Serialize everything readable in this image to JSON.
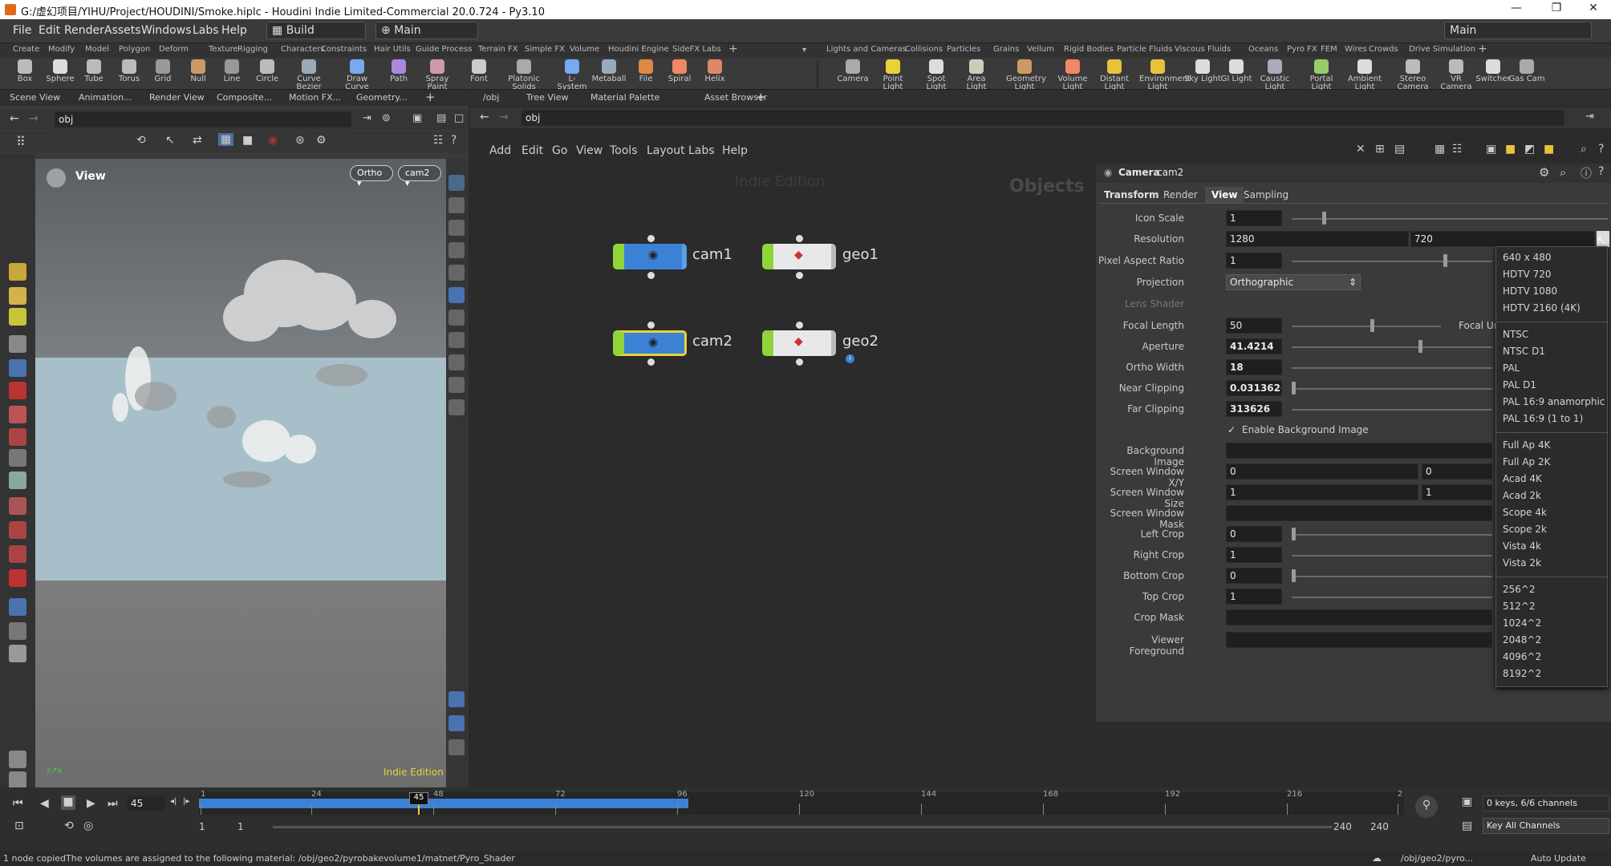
{
  "window": {
    "title": "G:/虚幻项目/YIHU/Project/HOUDINI/Smoke.hiplc - Houdini Indie Limited-Commercial 20.0.724 - Py3.10",
    "minimize": "—",
    "maximize": "❐",
    "close": "✕"
  },
  "menubar": {
    "items": [
      "File",
      "Edit",
      "Render",
      "Assets",
      "Windows",
      "Labs",
      "Help"
    ],
    "build_label": "Build",
    "main_label": "Main",
    "desktop_label": "Main"
  },
  "shelf_tabs_left": [
    "Create",
    "Modify",
    "Model",
    "Polygon",
    "Deform",
    "Texture",
    "Rigging",
    "Characters",
    "Constraints",
    "Hair Utils",
    "Guide Process",
    "Terrain FX",
    "Simple FX",
    "Volume",
    "Houdini Engine",
    "SideFX Labs"
  ],
  "shelf_tabs_right": [
    "Lights and Cameras",
    "Collisions",
    "Particles",
    "Grains",
    "Vellum",
    "Rigid Bodies",
    "Particle Fluids",
    "Viscous Fluids",
    "Oceans",
    "Pyro FX",
    "FEM",
    "Wires",
    "Crowds",
    "Drive Simulation"
  ],
  "shelf_tools_left": [
    "Box",
    "Sphere",
    "Tube",
    "Torus",
    "Grid",
    "Null",
    "Line",
    "Circle",
    "Curve Bezier",
    "Draw Curve",
    "Path",
    "Spray Paint",
    "Font",
    "Platonic Solids",
    "L-System",
    "Metaball",
    "File",
    "Spiral",
    "Helix"
  ],
  "shelf_tools_right": [
    "Camera",
    "Point Light",
    "Spot Light",
    "Area Light",
    "Geometry Light",
    "Volume Light",
    "Distant Light",
    "Environment Light",
    "Sky Light",
    "GI Light",
    "Caustic Light",
    "Portal Light",
    "Ambient Light",
    "Stereo Camera",
    "VR Camera",
    "Switcher",
    "Gas Cam"
  ],
  "left_pane": {
    "tabs": [
      "Scene View",
      "Animation...",
      "Render View",
      "Composite...",
      "Motion FX...",
      "Geometry..."
    ],
    "path": "obj",
    "view_label": "View",
    "ortho_label": "Ortho",
    "camera_label": "cam2",
    "watermark": "Indie Edition"
  },
  "network": {
    "tabs": [
      "/obj",
      "Tree View",
      "Material Palette",
      "Asset Browser"
    ],
    "path": "obj",
    "menu": [
      "Add",
      "Edit",
      "Go",
      "View",
      "Tools",
      "Layout",
      "Labs",
      "Help"
    ],
    "watermark": "Indie Edition",
    "context_label": "Objects",
    "nodes": [
      {
        "name": "cam1"
      },
      {
        "name": "geo1"
      },
      {
        "name": "cam2"
      },
      {
        "name": "geo2"
      }
    ]
  },
  "params": {
    "node_type": "Camera",
    "node_name": "cam2",
    "tabs": [
      "Transform",
      "Render",
      "View",
      "Sampling"
    ],
    "active_tab": "View",
    "rows": {
      "icon_scale": {
        "label": "Icon Scale",
        "value": "1"
      },
      "resolution": {
        "label": "Resolution",
        "x": "1280",
        "y": "720"
      },
      "pixel_aspect": {
        "label": "Pixel Aspect Ratio",
        "value": "1"
      },
      "projection": {
        "label": "Projection",
        "value": "Orthographic"
      },
      "lens_shader": {
        "label": "Lens Shader"
      },
      "focal_length": {
        "label": "Focal Length",
        "value": "50",
        "units_label": "Focal Un"
      },
      "aperture": {
        "label": "Aperture",
        "value": "41.4214"
      },
      "ortho_width": {
        "label": "Ortho Width",
        "value": "18"
      },
      "near_clipping": {
        "label": "Near Clipping",
        "value": "0.0313626"
      },
      "far_clipping": {
        "label": "Far Clipping",
        "value": "313626"
      },
      "enable_bg": {
        "label": "Enable Background Image"
      },
      "bg_image": {
        "label": "Background Image"
      },
      "screen_window_xy": {
        "label": "Screen Window X/Y",
        "x": "0",
        "y": "0"
      },
      "screen_window_size": {
        "label": "Screen Window Size",
        "x": "1",
        "y": "1"
      },
      "screen_window_mask": {
        "label": "Screen Window Mask"
      },
      "left_crop": {
        "label": "Left Crop",
        "value": "0"
      },
      "right_crop": {
        "label": "Right Crop",
        "value": "1"
      },
      "bottom_crop": {
        "label": "Bottom Crop",
        "value": "0"
      },
      "top_crop": {
        "label": "Top Crop",
        "value": "1"
      },
      "crop_mask": {
        "label": "Crop Mask"
      },
      "viewer_foreground": {
        "label": "Viewer Foreground"
      }
    }
  },
  "resolution_menu": {
    "groups": [
      [
        "640 x 480",
        "HDTV 720",
        "HDTV 1080",
        "HDTV 2160 (4K)"
      ],
      [
        "NTSC",
        "NTSC D1",
        "PAL",
        "PAL D1",
        "PAL 16:9 anamorphic",
        "PAL 16:9 (1 to 1)"
      ],
      [
        "Full Ap 4K",
        "Full Ap 2K",
        "Acad 4K",
        "Acad 2k",
        "Scope 4k",
        "Scope 2k",
        "Vista 4k",
        "Vista 2k"
      ],
      [
        "256^2",
        "512^2",
        "1024^2",
        "2048^2",
        "4096^2",
        "8192^2"
      ]
    ]
  },
  "timeline": {
    "current_frame": "45",
    "marker": "45",
    "ticks": [
      "1",
      "24",
      "48",
      "72",
      "96",
      "120",
      "144",
      "168",
      "192",
      "216",
      "2"
    ],
    "start": "1",
    "start2": "1",
    "end": "240",
    "end2": "240",
    "keys_info": "0 keys, 6/6 channels",
    "key_all": "Key All Channels",
    "playback_fraction": 0.4
  },
  "statusbar": {
    "message": "1 node copiedThe volumes are assigned to the following material: /obj/geo2/pyrobakevolume1/matnet/Pyro_Shader",
    "path": "/obj/geo2/pyro...",
    "update": "Auto Update"
  },
  "colors": {
    "accent_blue": "#3b82d6",
    "selected_yellow": "#e8d23a",
    "viewport_sky": "#a7bfc9"
  }
}
